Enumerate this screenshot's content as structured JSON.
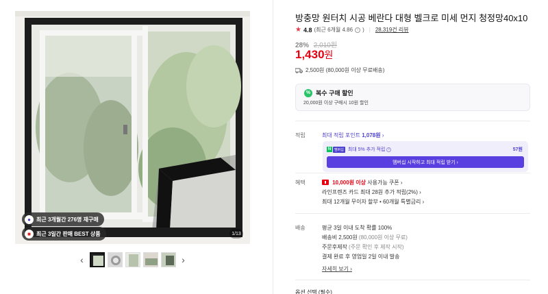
{
  "gallery": {
    "badges": [
      {
        "icon": "bag-icon",
        "text": "최근 3개월간 276명 재구매"
      },
      {
        "icon": "trophy-icon",
        "text": "최근 3일간 판매 BEST 상품"
      }
    ],
    "counter": "1/13",
    "prev_label": "‹",
    "next_label": "›",
    "thumb_count": 5
  },
  "product": {
    "title": "방충망 원터치 시공 베란다 대형 벨크로 미세 먼지 청정망40x10",
    "rating": {
      "score": "4.8",
      "recent": "(최근 6개월 4.86",
      "recent_close": ")",
      "reviews": "28,319건 리뷰"
    },
    "discount_rate": "28%",
    "original_price": "2,010원",
    "price": "1,430",
    "price_unit": "원",
    "shipping_summary": "2,500원 (80,000원 이상 무료배송)"
  },
  "multi_buy": {
    "title": "복수 구매 할인",
    "desc": "20,000원 이상 구매시 10원 할인"
  },
  "points": {
    "label": "적립",
    "max_text": "최대 적립 포인트",
    "max_value": "1,078원",
    "membership_badge": "멤버십",
    "membership_text": "최대 5% 추가 적립",
    "membership_points": "57원",
    "membership_button": "멤버십 시작하고 최대 적립 받기 ›"
  },
  "benefits": {
    "label": "혜택",
    "coupon_amount": "10,000원 이상",
    "coupon_text": "사용가능 쿠폰 ›",
    "card_text": "라인프렌즈 카드 최대 28원 추가 적립(2%) ›",
    "installment_text": "최대 12개월 무이자 할부 • 60개월 특별금리 ›"
  },
  "delivery": {
    "label": "배송",
    "line1": "평균 3일 이내 도착 확률 100%",
    "line2_main": "배송비 2,500원",
    "line2_sub": "(80,000원 이상 무료)",
    "line3_main": "주문후제작",
    "line3_sub": "(주문 확인 후 제작 시작)",
    "line4": "결제 완료 후 영업일 2일 이내 발송",
    "more_link": "자세히 보기 ›"
  },
  "option_label": "옵션 선택 (필수)",
  "colors": {
    "accent": "#4b3fce",
    "price_red": "#e60012",
    "star_red": "#e63946",
    "member_button": "#5a3fe0",
    "green": "#28c46a"
  }
}
